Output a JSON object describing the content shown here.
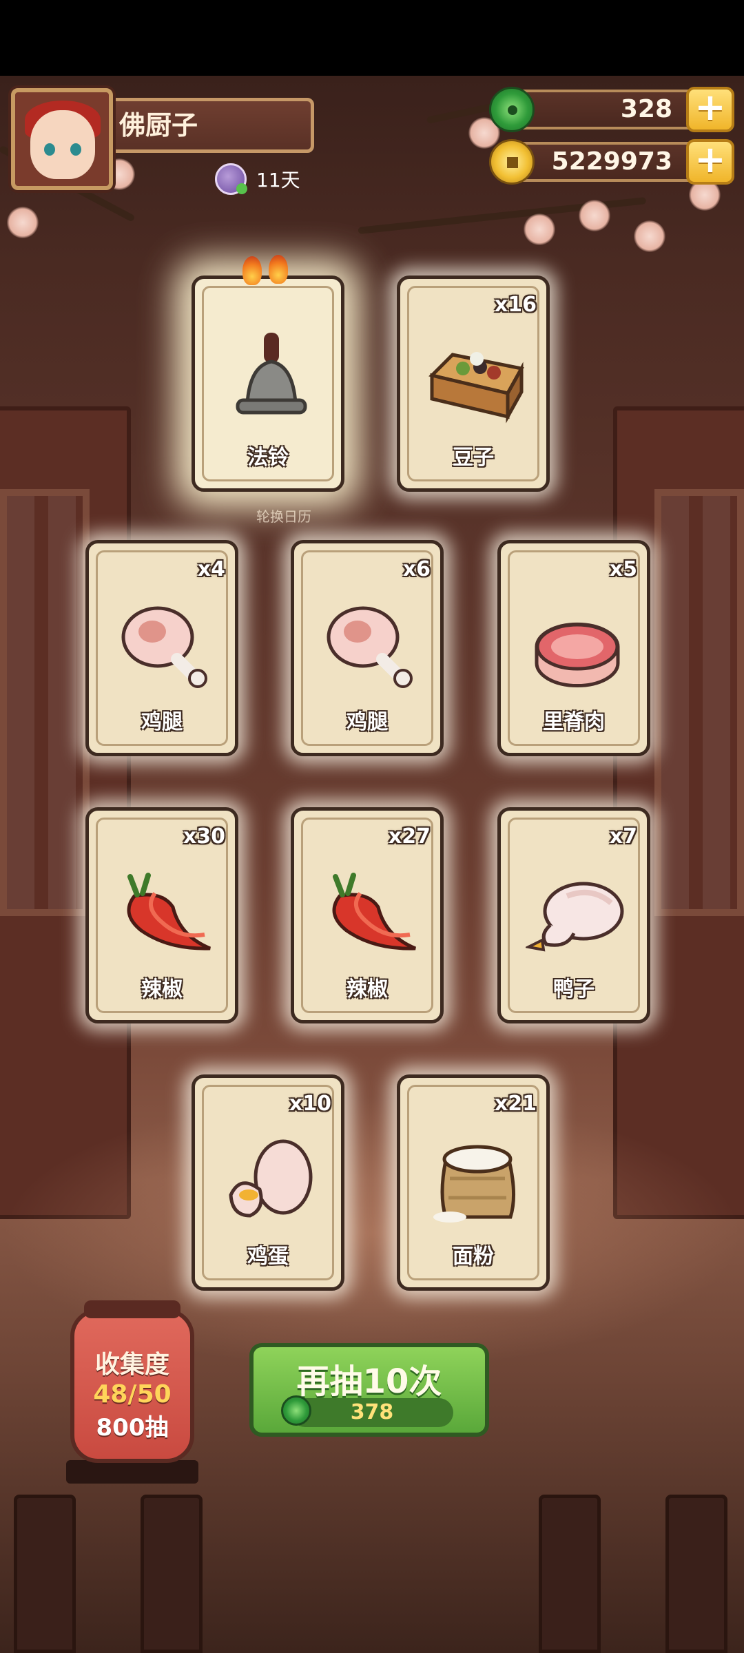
{
  "player": {
    "name": "佛厨子",
    "days": "11天"
  },
  "currency": {
    "jade": "328",
    "coins": "5229973",
    "plus_symbol": "+"
  },
  "board": {
    "calendar_label": "轮换日历"
  },
  "cards": [
    {
      "name": "法铃",
      "qty": "",
      "icon": "bell-icon",
      "featured": true
    },
    {
      "name": "豆子",
      "qty": "x16",
      "icon": "bean-box-icon",
      "featured": false
    },
    {
      "name": "鸡腿",
      "qty": "x4",
      "icon": "chicken-leg-icon",
      "featured": false
    },
    {
      "name": "鸡腿",
      "qty": "x6",
      "icon": "chicken-leg-icon",
      "featured": false
    },
    {
      "name": "里脊肉",
      "qty": "x5",
      "icon": "pork-loin-icon",
      "featured": false
    },
    {
      "name": "辣椒",
      "qty": "x30",
      "icon": "chili-pepper-icon",
      "featured": false
    },
    {
      "name": "辣椒",
      "qty": "x27",
      "icon": "chili-pepper-icon",
      "featured": false
    },
    {
      "name": "鸭子",
      "qty": "x7",
      "icon": "duck-icon",
      "featured": false
    },
    {
      "name": "鸡蛋",
      "qty": "x10",
      "icon": "egg-icon",
      "featured": false
    },
    {
      "name": "面粉",
      "qty": "x21",
      "icon": "flour-sack-icon",
      "featured": false
    }
  ],
  "collection": {
    "title": "收集度",
    "progress": "48/50",
    "draws": "800抽"
  },
  "draw_button": {
    "label": "再抽10次",
    "cost": "378"
  },
  "colors": {
    "accent_green": "#5aa83a",
    "gold": "#f0b52a",
    "card_bg": "#f0e2c3"
  }
}
